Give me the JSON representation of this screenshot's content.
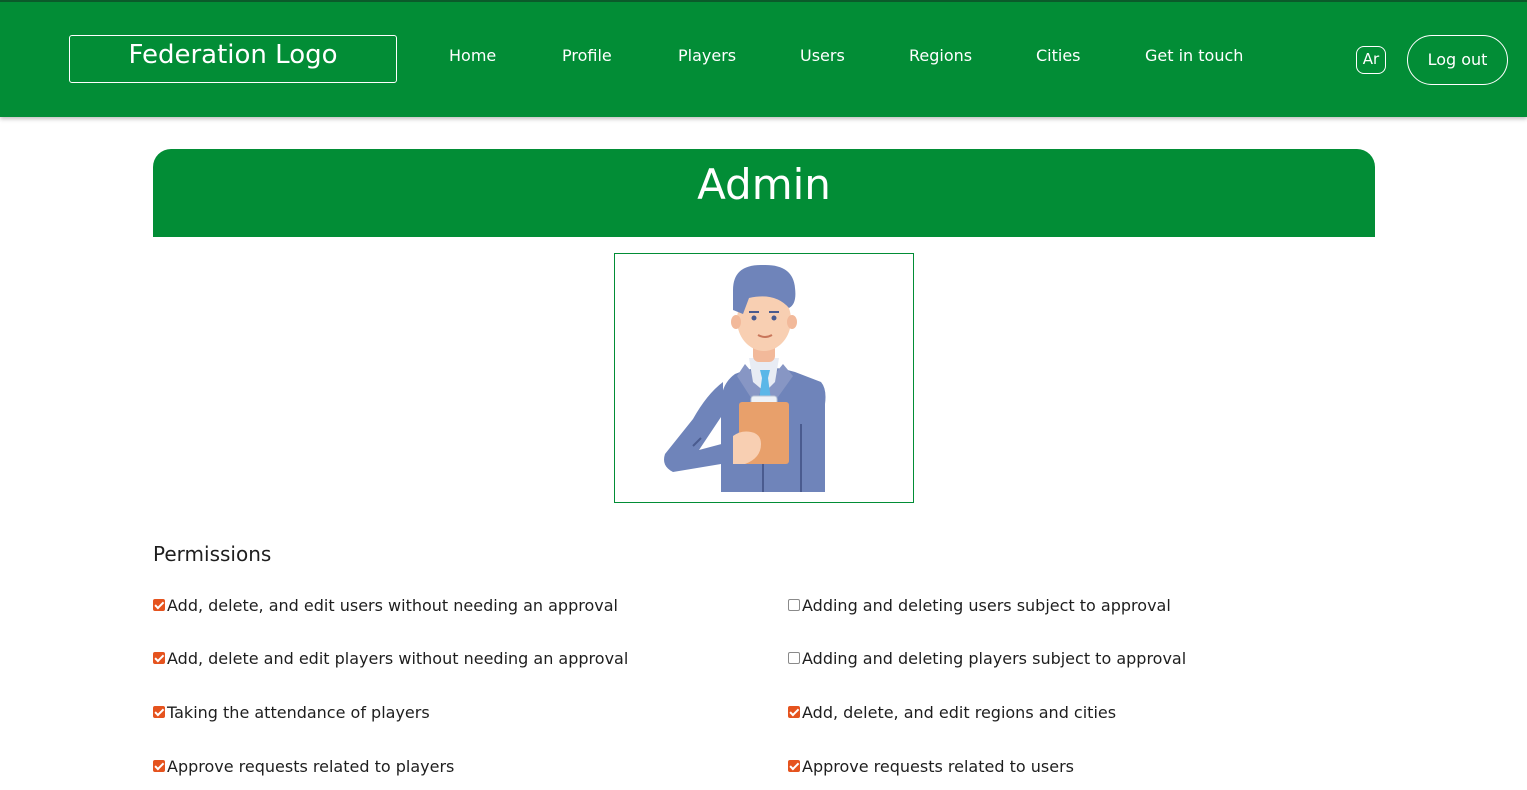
{
  "navbar": {
    "logo_text": "Federation Logo",
    "links": [
      "Home",
      "Profile",
      "Players",
      "Users",
      "Regions",
      "Cities",
      "Get in touch"
    ],
    "language_label": "Ar",
    "logout_label": "Log out",
    "background_color": "#028d36"
  },
  "header": {
    "title": "Admin"
  },
  "avatar": {
    "icon": "admin-avatar-illustration"
  },
  "permissions": {
    "title": "Permissions",
    "checked_color": "#e5531e",
    "items": [
      {
        "label": "Add, delete, and edit users without needing an approval",
        "checked": true
      },
      {
        "label": "Adding and deleting users subject to approval",
        "checked": false
      },
      {
        "label": "Add, delete and edit players without needing an approval",
        "checked": true
      },
      {
        "label": "Adding and deleting players subject to approval",
        "checked": false
      },
      {
        "label": "Taking the attendance of players",
        "checked": true
      },
      {
        "label": "Add, delete, and edit regions and cities",
        "checked": true
      },
      {
        "label": "Approve requests related to players",
        "checked": true
      },
      {
        "label": "Approve requests related to users",
        "checked": true
      }
    ]
  }
}
